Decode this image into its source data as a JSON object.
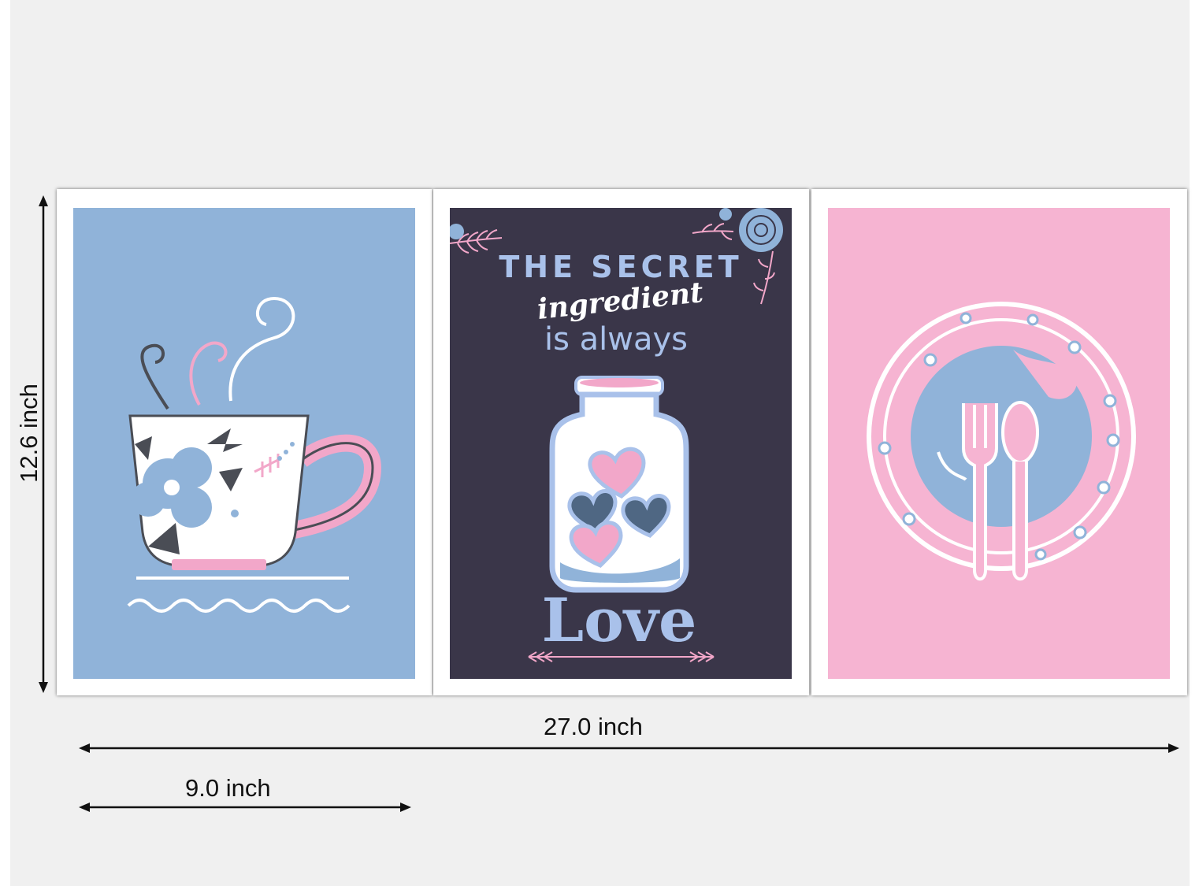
{
  "dimensions": {
    "height_label": "12.6 inch",
    "total_width_label": "27.0 inch",
    "panel_width_label": "9.0 inch"
  },
  "panels": [
    {
      "name": "teacup-print",
      "background": "#90b3d9",
      "icon": "teacup-icon"
    },
    {
      "name": "secret-ingredient-print",
      "background": "#3a3649",
      "icon": "jar-of-hearts-icon",
      "line1": "THE SECRET",
      "line2": "ingredient",
      "line3": "is always",
      "line4": "Love"
    },
    {
      "name": "plate-cutlery-print",
      "background": "#f6b4d2",
      "icon": "plate-fork-spoon-icon"
    }
  ],
  "colors": {
    "blue": "#90b3d9",
    "navy": "#3a3649",
    "pink": "#f6b4d2",
    "dark_gray": "#4a4d55"
  }
}
